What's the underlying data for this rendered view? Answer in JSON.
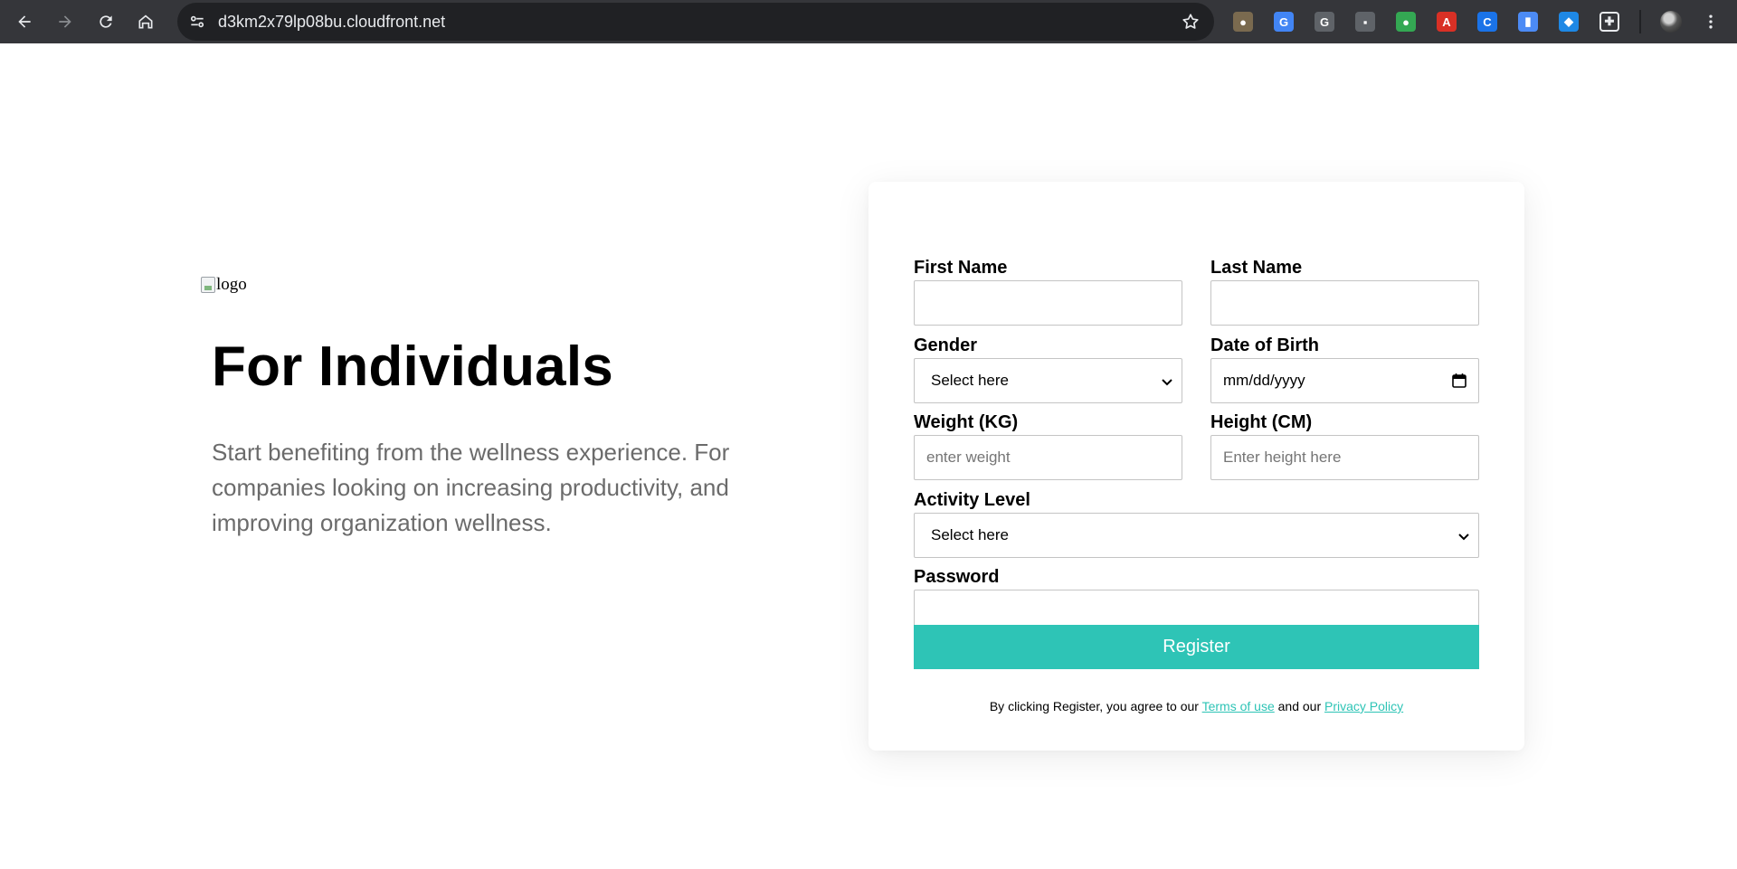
{
  "browser": {
    "url": "d3km2x79lp08bu.cloudfront.net",
    "nav": {
      "back": "back-arrow-icon",
      "forward": "forward-arrow-icon",
      "reload": "reload-icon",
      "home": "home-icon"
    },
    "extensions": [
      {
        "name": "owl-extension-icon",
        "glyph": "●",
        "color": "#7a6a4f"
      },
      {
        "name": "google-translate-extension-icon",
        "glyph": "G",
        "color": "#4285f4"
      },
      {
        "name": "grammarly-extension-icon",
        "glyph": "G",
        "color": "#5f6368"
      },
      {
        "name": "robot-extension-icon",
        "glyph": "▪",
        "color": "#5f6368"
      },
      {
        "name": "colorful-extension-icon",
        "glyph": "●",
        "color": "#34a853"
      },
      {
        "name": "adobe-pdf-extension-icon",
        "glyph": "A",
        "color": "#d93025"
      },
      {
        "name": "c-extension-icon",
        "glyph": "C",
        "color": "#1a73e8"
      },
      {
        "name": "document-extension-icon",
        "glyph": "▮",
        "color": "#4c8bf5"
      },
      {
        "name": "gem-extension-icon",
        "glyph": "◆",
        "color": "#1e88e5"
      },
      {
        "name": "extensions-puzzle-icon",
        "glyph": "✚",
        "color": "#35363a"
      }
    ],
    "profile": "profile-avatar",
    "menu": "more-menu-icon"
  },
  "page": {
    "logo_alt": "logo",
    "hero_title": "For Individuals",
    "hero_text": "Start benefiting from the wellness experience. For companies looking on increasing productivity, and improving organization wellness."
  },
  "form": {
    "first_name": {
      "label": "First Name",
      "value": ""
    },
    "last_name": {
      "label": "Last Name",
      "value": ""
    },
    "gender": {
      "label": "Gender",
      "selected": "Select here"
    },
    "dob": {
      "label": "Date of Birth",
      "placeholder": "mm/dd/yyyy"
    },
    "weight": {
      "label": "Weight (KG)",
      "placeholder": "enter weight"
    },
    "height": {
      "label": "Height (CM)",
      "placeholder": "Enter height here"
    },
    "activity": {
      "label": "Activity Level",
      "selected": "Select here"
    },
    "password": {
      "label": "Password",
      "value": ""
    },
    "register_label": "Register",
    "agree_prefix": "By clicking Register, you agree to our ",
    "terms_label": "Terms of use",
    "agree_middle": " and our ",
    "privacy_label": "Privacy Policy",
    "accent_color": "#2ec4b6"
  }
}
